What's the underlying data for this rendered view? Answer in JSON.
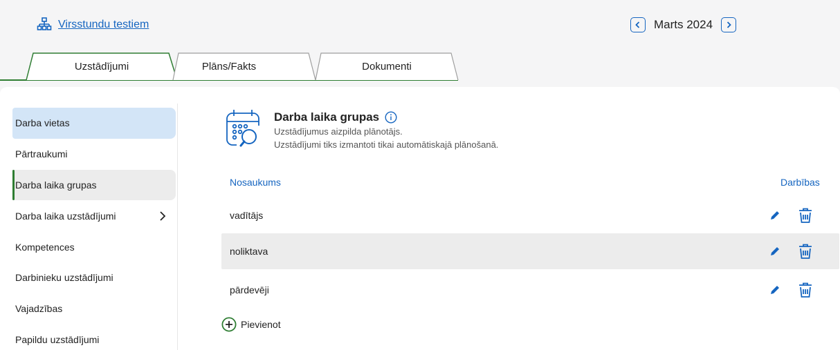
{
  "header": {
    "org_link": "Virsstundu testiem",
    "month": "Marts 2024"
  },
  "tabs": [
    {
      "label": "Uzstādījumi",
      "active": true
    },
    {
      "label": "Plāns/Fakts",
      "active": false
    },
    {
      "label": "Dokumenti",
      "active": false
    }
  ],
  "sidebar": {
    "items": [
      {
        "label": "Darba vietas"
      },
      {
        "label": "Pārtraukumi"
      },
      {
        "label": "Darba laika grupas"
      },
      {
        "label": "Darba laika uzstādījumi"
      },
      {
        "label": "Kompetences"
      },
      {
        "label": "Darbinieku uzstādījumi"
      },
      {
        "label": "Vajadzības"
      },
      {
        "label": "Papildu uzstādījumi"
      }
    ]
  },
  "section": {
    "title": "Darba laika grupas",
    "desc_1": "Uzstādījumus aizpilda plānotājs.",
    "desc_2": "Uzstādījumi tiks izmantoti tikai automātiskajā plānošanā."
  },
  "table": {
    "col_name": "Nosaukums",
    "col_actions": "Darbības",
    "rows": [
      {
        "name": "vadītājs"
      },
      {
        "name": "noliktava"
      },
      {
        "name": "pārdevēji"
      }
    ]
  },
  "add_label": "Pievienot",
  "colors": {
    "accent_blue": "#1565c0",
    "accent_green": "#2e7d32",
    "selected_bg": "#d3e5f7"
  }
}
